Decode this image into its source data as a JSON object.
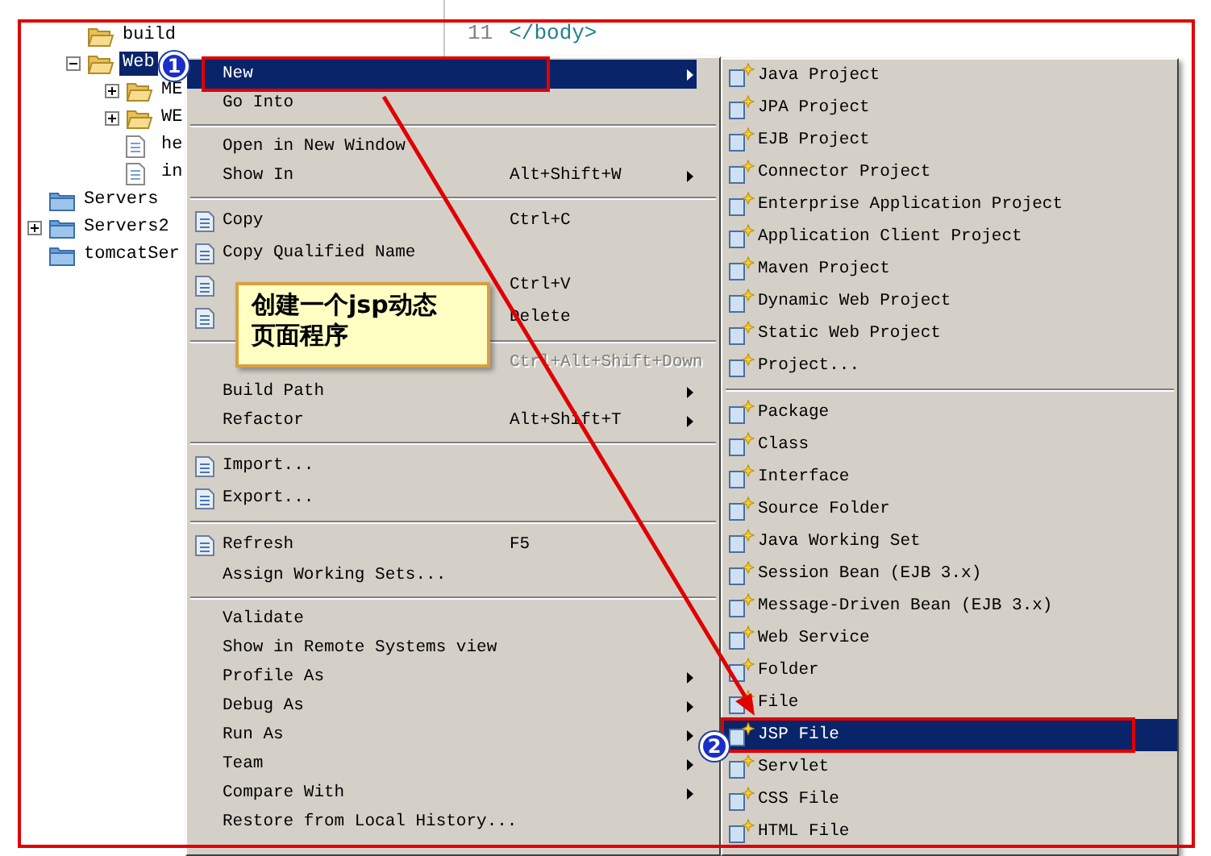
{
  "tree": {
    "items": [
      {
        "kind": "group",
        "children": [
          {
            "label": "build",
            "kind": "folder",
            "selected": false
          },
          {
            "label": "Web",
            "kind": "folder",
            "expanded": true,
            "selected": true,
            "children": [
              {
                "label": "ME",
                "kind": "folder",
                "expanded": false,
                "selected": false
              },
              {
                "label": "WE",
                "kind": "folder",
                "expanded": false,
                "selected": false
              },
              {
                "label": "he",
                "kind": "file",
                "selected": false
              },
              {
                "label": "in",
                "kind": "file",
                "selected": false
              }
            ]
          }
        ]
      },
      {
        "label": "Servers",
        "kind": "project",
        "selected": false
      },
      {
        "label": "Servers2",
        "kind": "project",
        "expanded": false,
        "selected": false
      },
      {
        "label": "tomcatSer",
        "kind": "project",
        "selected": false
      }
    ]
  },
  "editor": {
    "line_number": "11",
    "code": "</body>"
  },
  "context_menu": {
    "items": [
      {
        "kind": "item",
        "label": "New",
        "icon": false,
        "submenu": true,
        "selected": true,
        "disabled": false
      },
      {
        "kind": "item",
        "label": "Go Into",
        "icon": false,
        "submenu": false,
        "selected": false,
        "disabled": false
      },
      {
        "kind": "separator"
      },
      {
        "kind": "item",
        "label": "Open in New Window",
        "icon": false,
        "submenu": false,
        "selected": false,
        "disabled": false
      },
      {
        "kind": "item",
        "label": "Show In",
        "shortcut": "Alt+Shift+W",
        "icon": false,
        "submenu": true,
        "selected": false,
        "disabled": false
      },
      {
        "kind": "separator"
      },
      {
        "kind": "item",
        "label": "Copy",
        "shortcut": "Ctrl+C",
        "icon": true,
        "submenu": false,
        "selected": false,
        "disabled": false
      },
      {
        "kind": "item",
        "label": "Copy Qualified Name",
        "icon": true,
        "submenu": false,
        "selected": false,
        "disabled": false
      },
      {
        "kind": "item",
        "shortcut": "Ctrl+V",
        "icon": true,
        "submenu": false,
        "selected": false,
        "disabled": false
      },
      {
        "kind": "item",
        "shortcut": "Delete",
        "icon": true,
        "submenu": false,
        "selected": false,
        "disabled": false
      },
      {
        "kind": "separator"
      },
      {
        "kind": "item",
        "shortcut": "Ctrl+Alt+Shift+Down",
        "icon": false,
        "submenu": false,
        "selected": false,
        "disabled": true
      },
      {
        "kind": "item",
        "label": "Build Path",
        "icon": false,
        "submenu": true,
        "selected": false,
        "disabled": false
      },
      {
        "kind": "item",
        "label": "Refactor",
        "shortcut": "Alt+Shift+T",
        "icon": false,
        "submenu": true,
        "selected": false,
        "disabled": false
      },
      {
        "kind": "separator"
      },
      {
        "kind": "item",
        "label": "Import...",
        "icon": true,
        "submenu": false,
        "selected": false,
        "disabled": false
      },
      {
        "kind": "item",
        "label": "Export...",
        "icon": true,
        "submenu": false,
        "selected": false,
        "disabled": false
      },
      {
        "kind": "separator"
      },
      {
        "kind": "item",
        "label": "Refresh",
        "shortcut": "F5",
        "icon": true,
        "submenu": false,
        "selected": false,
        "disabled": false
      },
      {
        "kind": "item",
        "label": "Assign Working Sets...",
        "icon": false,
        "submenu": false,
        "selected": false,
        "disabled": false
      },
      {
        "kind": "separator"
      },
      {
        "kind": "item",
        "label": "Validate",
        "icon": false,
        "submenu": false,
        "selected": false,
        "disabled": false
      },
      {
        "kind": "item",
        "label": "Show in Remote Systems view",
        "icon": false,
        "submenu": false,
        "selected": false,
        "disabled": false
      },
      {
        "kind": "item",
        "label": "Profile As",
        "icon": false,
        "submenu": true,
        "selected": false,
        "disabled": false
      },
      {
        "kind": "item",
        "label": "Debug As",
        "icon": false,
        "submenu": true,
        "selected": false,
        "disabled": false
      },
      {
        "kind": "item",
        "label": "Run As",
        "icon": false,
        "submenu": true,
        "selected": false,
        "disabled": false
      },
      {
        "kind": "item",
        "label": "Team",
        "icon": false,
        "submenu": true,
        "selected": false,
        "disabled": false
      },
      {
        "kind": "item",
        "label": "Compare With",
        "icon": false,
        "submenu": true,
        "selected": false,
        "disabled": false
      },
      {
        "kind": "item",
        "label": "Restore from Local History...",
        "icon": false,
        "submenu": false,
        "selected": false,
        "disabled": false
      }
    ]
  },
  "submenu": {
    "items": [
      {
        "kind": "item",
        "label": "Java Project",
        "selected": false
      },
      {
        "kind": "item",
        "label": "JPA Project",
        "selected": false
      },
      {
        "kind": "item",
        "label": "EJB Project",
        "selected": false
      },
      {
        "kind": "item",
        "label": "Connector Project",
        "selected": false
      },
      {
        "kind": "item",
        "label": "Enterprise Application Project",
        "selected": false
      },
      {
        "kind": "item",
        "label": "Application Client Project",
        "selected": false
      },
      {
        "kind": "item",
        "label": "Maven Project",
        "selected": false
      },
      {
        "kind": "item",
        "label": "Dynamic Web Project",
        "selected": false
      },
      {
        "kind": "item",
        "label": "Static Web Project",
        "selected": false
      },
      {
        "kind": "item",
        "label": "Project...",
        "selected": false
      },
      {
        "kind": "separator"
      },
      {
        "kind": "item",
        "label": "Package",
        "selected": false
      },
      {
        "kind": "item",
        "label": "Class",
        "selected": false
      },
      {
        "kind": "item",
        "label": "Interface",
        "selected": false
      },
      {
        "kind": "item",
        "label": "Source Folder",
        "selected": false
      },
      {
        "kind": "item",
        "label": "Java Working Set",
        "selected": false
      },
      {
        "kind": "item",
        "label": "Session Bean (EJB 3.x)",
        "selected": false
      },
      {
        "kind": "item",
        "label": "Message-Driven Bean (EJB 3.x)",
        "selected": false
      },
      {
        "kind": "item",
        "label": "Web Service",
        "selected": false
      },
      {
        "kind": "item",
        "label": "Folder",
        "selected": false
      },
      {
        "kind": "item",
        "label": "File",
        "selected": false
      },
      {
        "kind": "item",
        "label": "JSP File",
        "selected": true
      },
      {
        "kind": "item",
        "label": "Servlet",
        "selected": false
      },
      {
        "kind": "item",
        "label": "CSS File",
        "selected": false
      },
      {
        "kind": "item",
        "label": "HTML File",
        "selected": false
      }
    ]
  },
  "annotations": {
    "badges": [
      "1",
      "2"
    ],
    "callout": "创建一个jsp动态页面程序"
  }
}
